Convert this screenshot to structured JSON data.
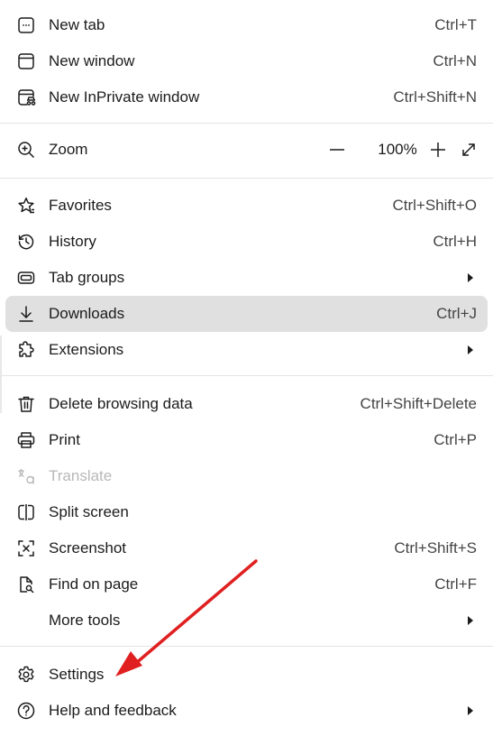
{
  "colors": {
    "highlight": "#e0e0e0",
    "disabled_text": "#b8b8b8",
    "arrow": "#e02020",
    "divider": "#e3e3e3"
  },
  "items": {
    "new_tab": {
      "label": "New tab",
      "shortcut": "Ctrl+T",
      "icon": "new-tab-icon"
    },
    "new_window": {
      "label": "New window",
      "shortcut": "Ctrl+N",
      "icon": "window-icon"
    },
    "new_inprivate": {
      "label": "New InPrivate window",
      "shortcut": "Ctrl+Shift+N",
      "icon": "inprivate-icon"
    },
    "zoom": {
      "label": "Zoom",
      "value": "100%",
      "icon": "zoom-icon"
    },
    "favorites": {
      "label": "Favorites",
      "shortcut": "Ctrl+Shift+O",
      "icon": "star-icon"
    },
    "history": {
      "label": "History",
      "shortcut": "Ctrl+H",
      "icon": "history-icon"
    },
    "tab_groups": {
      "label": "Tab groups",
      "icon": "tab-groups-icon"
    },
    "downloads": {
      "label": "Downloads",
      "shortcut": "Ctrl+J",
      "icon": "download-icon"
    },
    "extensions": {
      "label": "Extensions",
      "icon": "puzzle-icon"
    },
    "delete_browsing": {
      "label": "Delete browsing data",
      "shortcut": "Ctrl+Shift+Delete",
      "icon": "trash-icon"
    },
    "print": {
      "label": "Print",
      "shortcut": "Ctrl+P",
      "icon": "printer-icon"
    },
    "translate": {
      "label": "Translate",
      "icon": "translate-icon"
    },
    "split_screen": {
      "label": "Split screen",
      "icon": "split-screen-icon"
    },
    "screenshot": {
      "label": "Screenshot",
      "shortcut": "Ctrl+Shift+S",
      "icon": "screenshot-icon"
    },
    "find_on_page": {
      "label": "Find on page",
      "shortcut": "Ctrl+F",
      "icon": "find-page-icon"
    },
    "more_tools": {
      "label": "More tools"
    },
    "settings": {
      "label": "Settings",
      "icon": "gear-icon"
    },
    "help": {
      "label": "Help and feedback",
      "icon": "help-icon"
    }
  }
}
